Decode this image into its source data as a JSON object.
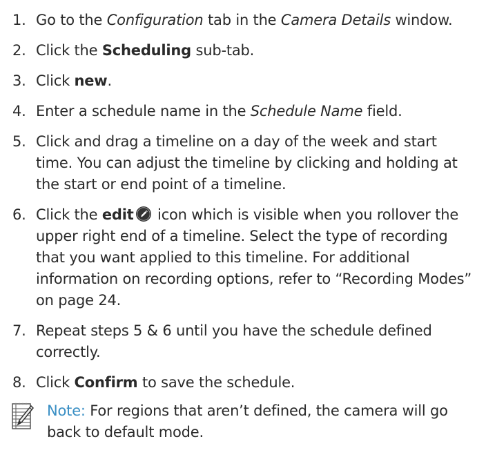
{
  "steps": [
    {
      "num": "1.",
      "t1": "Go to the ",
      "i1": "Configuration",
      "t2": " tab in the ",
      "i2": "Camera Details",
      "t3": " window."
    },
    {
      "num": "2.",
      "t1": "Click the ",
      "b1": "Scheduling",
      "t2": " sub-tab."
    },
    {
      "num": "3.",
      "t1": "Click ",
      "b1": "new",
      "t2": "."
    },
    {
      "num": "4.",
      "t1": "Enter a schedule name in the ",
      "i1": "Schedule Name",
      "t2": " field."
    },
    {
      "num": "5.",
      "text": "Click and drag a timeline on a day of the week and start time. You can adjust the timeline by clicking and holding at the start or end point of a timeline."
    },
    {
      "num": "6.",
      "t1": "Click the ",
      "b1": "edit",
      "t2": " icon which is visible when you rollover the upper right end of a timeline. Select the type of recording that you want applied to this timeline. For additional information on recording options, refer to “Recording Modes” on page 24."
    },
    {
      "num": "7.",
      "text": "Repeat steps 5 & 6 until you have the schedule defined correctly."
    },
    {
      "num": "8.",
      "t1": "Click ",
      "b1": "Confirm",
      "t2": " to save the schedule."
    }
  ],
  "note": {
    "label": "Note:",
    "text": " For regions that aren’t defined, the camera will go back to default mode."
  },
  "colors": {
    "text": "#2a2a2a",
    "note_label": "#3a8fc4",
    "icon_dark": "#333333"
  },
  "icons": {
    "edit": "edit-icon",
    "note": "notepad-pencil-icon"
  }
}
